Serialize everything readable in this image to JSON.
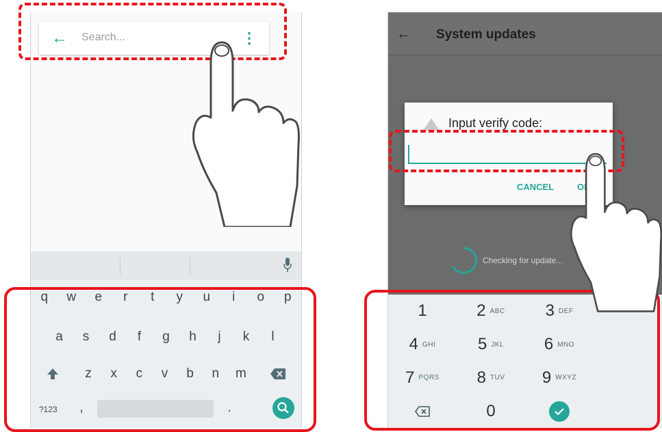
{
  "left_screen": {
    "search": {
      "back_icon": "arrow-left-icon",
      "placeholder": "Search...",
      "more_icon": "more-vert-icon"
    },
    "keyboard": {
      "row1": [
        "q",
        "w",
        "e",
        "r",
        "t",
        "y",
        "u",
        "i",
        "o",
        "p"
      ],
      "row2": [
        "a",
        "s",
        "d",
        "f",
        "g",
        "h",
        "j",
        "k",
        "l"
      ],
      "row3": [
        "z",
        "x",
        "c",
        "v",
        "b",
        "n",
        "m"
      ],
      "symbols_label": "?123",
      "comma": ",",
      "period": ".",
      "mic_icon": "mic-icon",
      "shift_icon": "shift-icon",
      "backspace_icon": "backspace-icon",
      "search_icon": "search-icon"
    }
  },
  "right_screen": {
    "title": "System updates",
    "back_icon": "arrow-left-icon",
    "dialog": {
      "title": "Input verify code:",
      "alert_icon": "warning-icon",
      "cancel_label": "CANCEL",
      "ok_label": "OK"
    },
    "status": "Checking for update...",
    "numpad": {
      "keys": [
        {
          "n": "1",
          "l": ""
        },
        {
          "n": "2",
          "l": "ABC"
        },
        {
          "n": "3",
          "l": "DEF"
        },
        {
          "n": "4",
          "l": "GHI"
        },
        {
          "n": "5",
          "l": "JKL"
        },
        {
          "n": "6",
          "l": "MNO"
        },
        {
          "n": "7",
          "l": "PQRS"
        },
        {
          "n": "8",
          "l": "TUV"
        },
        {
          "n": "9",
          "l": "WXYZ"
        },
        {
          "n": "",
          "l": ""
        },
        {
          "n": "0",
          "l": ""
        },
        {
          "n": "",
          "l": ""
        }
      ],
      "backspace_icon": "backspace-icon",
      "done_icon": "check-icon"
    }
  },
  "colors": {
    "accent": "#26a69a",
    "highlight": "#e8141c",
    "keyboard_bg": "#eceff1",
    "dim_bg": "#6a6d6b"
  }
}
